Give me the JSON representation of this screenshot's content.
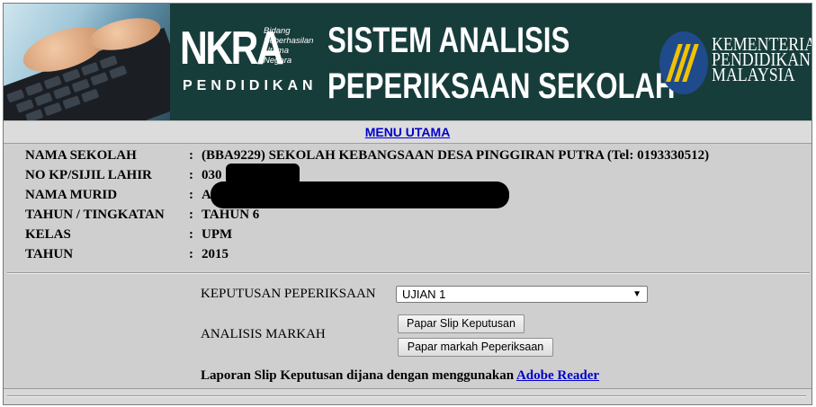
{
  "banner": {
    "nkra": "NKRA",
    "nkra_sub": [
      "Bidang",
      "Keberhasilan",
      "Utama",
      "Negara"
    ],
    "nkra_pendidikan": "PENDIDIKAN",
    "title_line1": "SISTEM ANALISIS",
    "title_line2": "PEPERIKSAAN SEKOLAH",
    "ministry": [
      "KEMENTERIAN",
      "PENDIDIKAN",
      "MALAYSIA"
    ]
  },
  "menu": {
    "label": "MENU UTAMA"
  },
  "student": {
    "rows": [
      {
        "label": "NAMA SEKOLAH",
        "value": "(BBA9229) SEKOLAH KEBANGSAAN DESA PINGGIRAN PUTRA (Tel: 0193330512)"
      },
      {
        "label": "NO KP/SIJIL LAHIR",
        "value": "030"
      },
      {
        "label": "NAMA MURID",
        "value": "A"
      },
      {
        "label": "TAHUN / TINGKATAN",
        "value": "TAHUN 6"
      },
      {
        "label": "KELAS",
        "value": "UPM"
      },
      {
        "label": "TAHUN",
        "value": "2015"
      }
    ],
    "colon": ":"
  },
  "exam": {
    "label": "KEPUTUSAN PEPERIKSAAN",
    "selected": "UJIAN 1"
  },
  "analysis": {
    "label": "ANALISIS MARKAH",
    "btn_slip": "Papar Slip Keputusan",
    "btn_markah": "Papar markah Peperiksaan"
  },
  "note": {
    "text": "Laporan Slip Keputusan dijana dengan menggunakan ",
    "link": "Adobe Reader"
  },
  "colors": {
    "banner_bg": "#173d3b",
    "link": "#0000cc",
    "page_bg": "#cfcfcf"
  }
}
